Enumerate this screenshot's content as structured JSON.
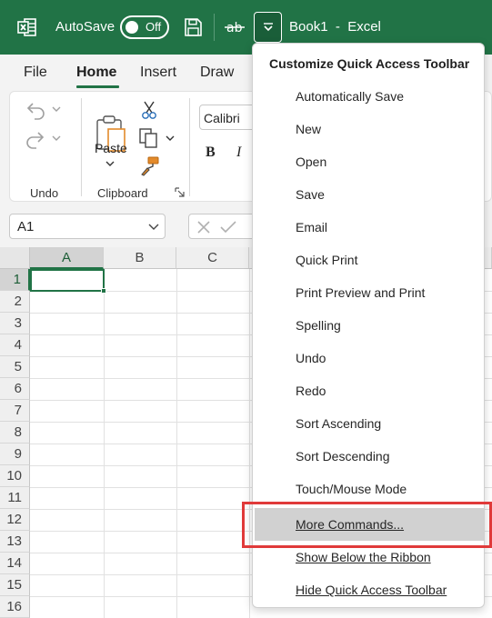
{
  "colors": {
    "brand": "#217346",
    "title_bar": "#217346",
    "menu_highlight": "#d1d1d1",
    "annotation_red": "#e03a3a"
  },
  "title_bar": {
    "app_icon": "excel-logo-icon",
    "autosave_label": "AutoSave",
    "autosave_state": "Off",
    "save_icon": "save-icon",
    "strikethrough_icon": "strikethrough-icon",
    "qat_dropdown_icon": "chevron-down-icon",
    "document_title": "Book1  -  Excel"
  },
  "ribbon": {
    "tabs": [
      {
        "label": "File",
        "selected": false
      },
      {
        "label": "Home",
        "selected": true
      },
      {
        "label": "Insert",
        "selected": false
      },
      {
        "label": "Draw",
        "selected": false
      }
    ],
    "undo_group": {
      "label": "Undo",
      "icons": [
        "undo-icon",
        "redo-icon"
      ]
    },
    "clipboard_group": {
      "label": "Clipboard",
      "paste_label": "Paste",
      "icons": [
        "paste-icon",
        "cut-icon",
        "copy-icon",
        "format-painter-icon",
        "dialog-launcher-icon"
      ]
    },
    "font_group": {
      "font_name": "Calibri",
      "bold_label": "B",
      "italic_label": "I"
    }
  },
  "formula_bar": {
    "name_box_value": "A1",
    "icons": [
      "cancel-icon",
      "enter-icon"
    ]
  },
  "sheet": {
    "columns": [
      "A",
      "B",
      "C"
    ],
    "rows": [
      "1",
      "2",
      "3",
      "4",
      "5",
      "6",
      "7",
      "8",
      "9",
      "10",
      "11",
      "12",
      "13",
      "14",
      "15",
      "16"
    ],
    "active_cell": "A1"
  },
  "qat_menu": {
    "heading": "Customize Quick Access Toolbar",
    "items": [
      {
        "label": "Automatically Save"
      },
      {
        "label": "New"
      },
      {
        "label": "Open"
      },
      {
        "label": "Save"
      },
      {
        "label": "Email"
      },
      {
        "label": "Quick Print"
      },
      {
        "label": "Print Preview and Print"
      },
      {
        "label": "Spelling"
      },
      {
        "label": "Undo"
      },
      {
        "label": "Redo"
      },
      {
        "label": "Sort Ascending"
      },
      {
        "label": "Sort Descending"
      },
      {
        "label": "Touch/Mouse Mode"
      },
      {
        "label": "More Commands...",
        "highlighted": true
      },
      {
        "label": "Show Below the Ribbon"
      },
      {
        "label": "Hide Quick Access Toolbar"
      }
    ]
  }
}
